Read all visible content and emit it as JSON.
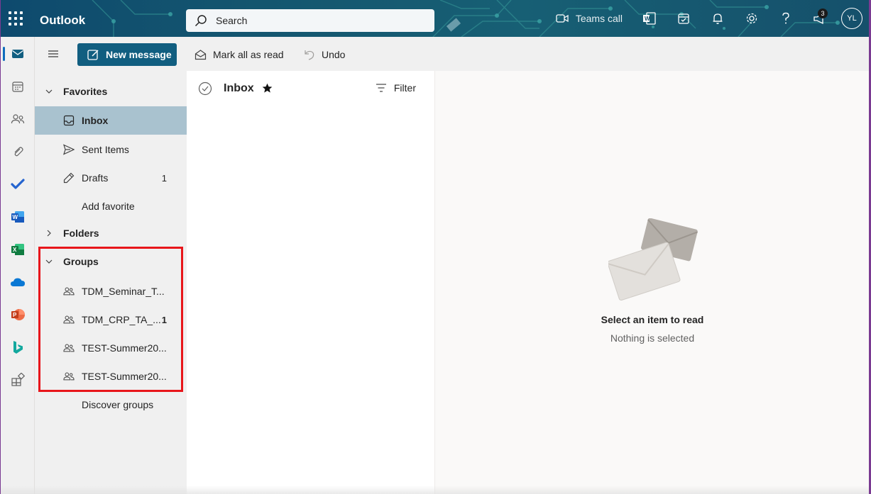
{
  "header": {
    "app_title": "Outlook",
    "search_placeholder": "Search",
    "teams_call_label": "Teams call",
    "notification_count": "3",
    "avatar_initials": "YL"
  },
  "toolbar": {
    "new_message_label": "New message",
    "mark_all_read_label": "Mark all as read",
    "undo_label": "Undo"
  },
  "rail": {
    "items": [
      "mail-icon",
      "calendar-icon",
      "people-icon",
      "attachment-icon",
      "todo-icon",
      "word-icon",
      "excel-icon",
      "onedrive-icon",
      "powerpoint-icon",
      "bing-icon",
      "apps-icon"
    ]
  },
  "folders": {
    "favorites_label": "Favorites",
    "inbox_label": "Inbox",
    "sent_label": "Sent Items",
    "drafts_label": "Drafts",
    "drafts_count": "1",
    "add_favorite_label": "Add favorite",
    "folders_label": "Folders",
    "groups_label": "Groups",
    "groups": [
      {
        "label": "TDM_Seminar_T...",
        "count": ""
      },
      {
        "label": "TDM_CRP_TA_...",
        "count": "1"
      },
      {
        "label": "TEST-Summer20...",
        "count": ""
      },
      {
        "label": "TEST-Summer20...",
        "count": ""
      }
    ],
    "discover_groups_label": "Discover groups"
  },
  "message_list": {
    "title": "Inbox",
    "filter_label": "Filter"
  },
  "reading_pane": {
    "title": "Select an item to read",
    "subtitle": "Nothing is selected"
  },
  "colors": {
    "accent": "#115e80",
    "selected_folder": "#a9c2cf",
    "highlight_box": "#e8161b"
  }
}
